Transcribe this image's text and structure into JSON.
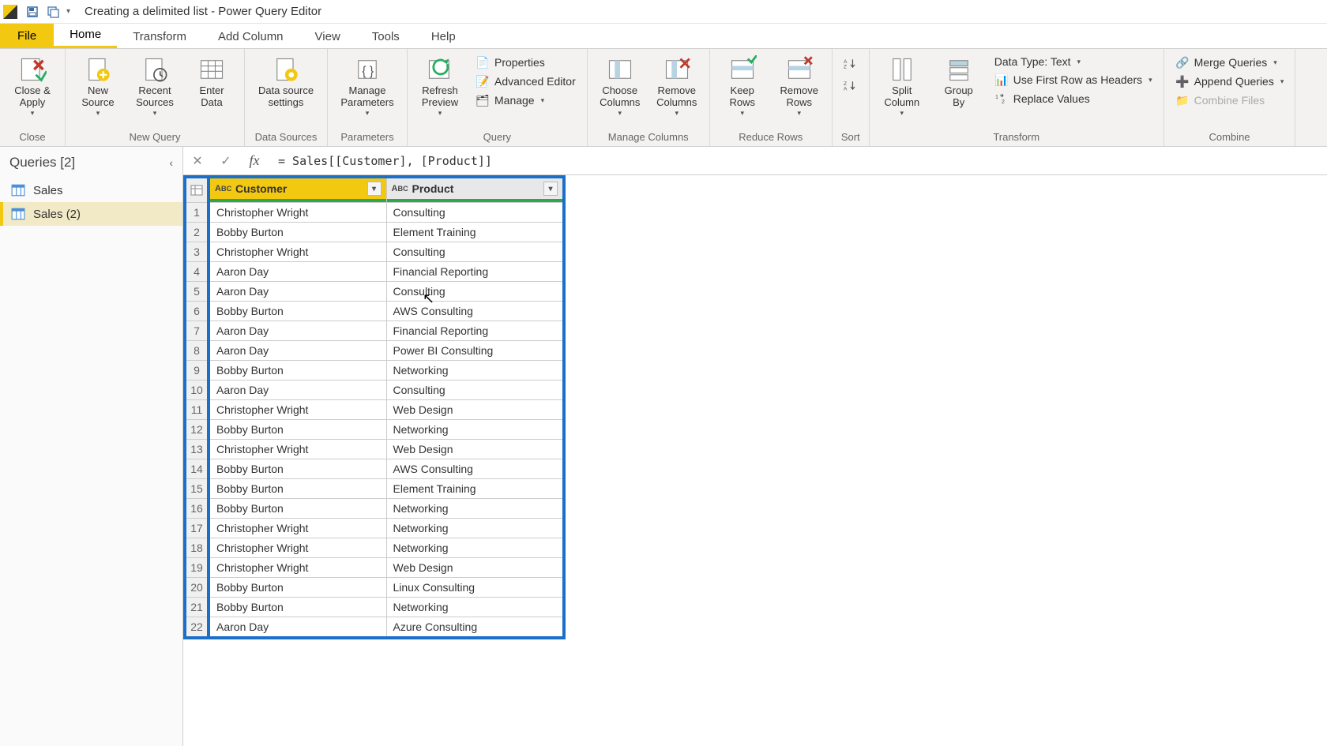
{
  "title": "Creating a delimited list - Power Query Editor",
  "menu_tabs": {
    "file": "File",
    "home": "Home",
    "transform": "Transform",
    "add_column": "Add Column",
    "view": "View",
    "tools": "Tools",
    "help": "Help"
  },
  "ribbon": {
    "close": {
      "close_apply": "Close &\nApply",
      "group": "Close"
    },
    "new_query": {
      "new_source": "New\nSource",
      "recent_sources": "Recent\nSources",
      "enter_data": "Enter\nData",
      "group": "New Query"
    },
    "data_sources": {
      "settings": "Data source\nsettings",
      "group": "Data Sources"
    },
    "parameters": {
      "manage": "Manage\nParameters",
      "group": "Parameters"
    },
    "query": {
      "refresh": "Refresh\nPreview",
      "properties": "Properties",
      "advanced": "Advanced Editor",
      "manage": "Manage",
      "group": "Query"
    },
    "manage_cols": {
      "choose": "Choose\nColumns",
      "remove": "Remove\nColumns",
      "group": "Manage Columns"
    },
    "reduce_rows": {
      "keep": "Keep\nRows",
      "remove": "Remove\nRows",
      "group": "Reduce Rows"
    },
    "sort": {
      "group": "Sort"
    },
    "transform": {
      "split": "Split\nColumn",
      "group_by": "Group\nBy",
      "data_type": "Data Type: Text",
      "first_row": "Use First Row as Headers",
      "replace": "Replace Values",
      "group": "Transform"
    },
    "combine": {
      "merge": "Merge Queries",
      "append": "Append Queries",
      "combine_files": "Combine Files",
      "group": "Combine"
    }
  },
  "queries": {
    "header": "Queries [2]",
    "items": [
      "Sales",
      "Sales (2)"
    ]
  },
  "formula": "= Sales[[Customer], [Product]]",
  "grid": {
    "columns": [
      "Customer",
      "Product"
    ],
    "type_icon": "ABC",
    "rows": [
      [
        "Christopher Wright",
        "Consulting"
      ],
      [
        "Bobby Burton",
        "Element Training"
      ],
      [
        "Christopher Wright",
        "Consulting"
      ],
      [
        "Aaron Day",
        "Financial Reporting"
      ],
      [
        "Aaron Day",
        "Consulting"
      ],
      [
        "Bobby Burton",
        "AWS Consulting"
      ],
      [
        "Aaron Day",
        "Financial Reporting"
      ],
      [
        "Aaron Day",
        "Power BI Consulting"
      ],
      [
        "Bobby Burton",
        "Networking"
      ],
      [
        "Aaron Day",
        "Consulting"
      ],
      [
        "Christopher Wright",
        "Web Design"
      ],
      [
        "Bobby Burton",
        "Networking"
      ],
      [
        "Christopher Wright",
        "Web Design"
      ],
      [
        "Bobby Burton",
        "AWS Consulting"
      ],
      [
        "Bobby Burton",
        "Element Training"
      ],
      [
        "Bobby Burton",
        "Networking"
      ],
      [
        "Christopher Wright",
        "Networking"
      ],
      [
        "Christopher Wright",
        "Networking"
      ],
      [
        "Christopher Wright",
        "Web Design"
      ],
      [
        "Bobby Burton",
        "Linux Consulting"
      ],
      [
        "Bobby Burton",
        "Networking"
      ],
      [
        "Aaron Day",
        "Azure Consulting"
      ]
    ]
  }
}
